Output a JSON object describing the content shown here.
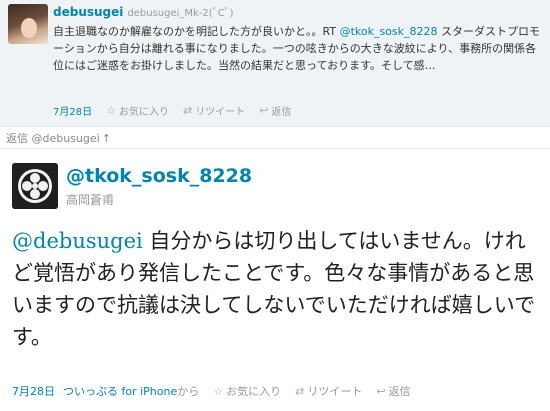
{
  "previous_tweet": {
    "screen_name": "debusugei",
    "display_name": "debusugei_Mk-2(ﾟCﾟ)",
    "text_before_mention": "自主退職なのか解雇なのかを明記した方が良いかと。。RT ",
    "mention": "@tkok_sosk_8228",
    "text_after_mention": " スターダストプロモーションから自分は離れる事になりました。一つの呟きからの大きな波紋により、事務所の関係各位にはご迷惑をお掛けしました。当然の結果だと思っております。そして感…",
    "date": "7月28日",
    "favorite_label": "お気に入り",
    "retweet_label": "リツイート",
    "reply_label": "返信"
  },
  "in_reply_to": {
    "label": "返信 @debusugei",
    "arrow": "↑"
  },
  "main_tweet": {
    "screen_name": "@tkok_sosk_8228",
    "display_name": "高岡蒼甫",
    "mention": "@debusugei",
    "text": " 自分からは切り出してはいません。けれど覚悟があり発信したことです。色々な事情があると思いますので抗議は決してしないでいただければ嬉しいです。",
    "date": "7月28日",
    "via_client": "ついっぷる for iPhone",
    "via_suffix": "から",
    "favorite_label": "お気に入り",
    "retweet_label": "リツイート",
    "reply_label": "返信"
  },
  "colors": {
    "link": "#0084b4",
    "meta": "#999999",
    "top_background": "#f0f3f5"
  },
  "icons": [
    "star-icon",
    "retweet-icon",
    "reply-icon",
    "family-crest-avatar"
  ]
}
